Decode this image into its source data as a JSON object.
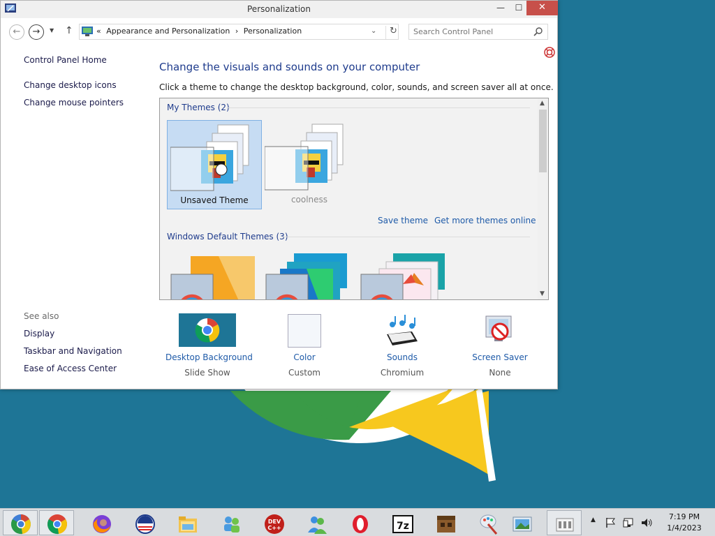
{
  "window": {
    "title": "Personalization",
    "minimize_glyph": "—",
    "maximize_glyph": "☐",
    "close_glyph": "✕"
  },
  "nav": {
    "back_glyph": "←",
    "forward_glyph": "→",
    "dropdown_glyph": "▼",
    "up_glyph": "↑"
  },
  "address": {
    "prefix": "«",
    "crumb_1": "Appearance and Personalization",
    "separator": "›",
    "crumb_2": "Personalization",
    "dropdown_glyph": "⌄",
    "refresh_glyph": "↻"
  },
  "search": {
    "placeholder": "Search Control Panel"
  },
  "sidebar": {
    "items": [
      "Control Panel Home",
      "Change desktop icons",
      "Change mouse pointers"
    ],
    "see_also_title": "See also",
    "see_also": [
      "Display",
      "Taskbar and Navigation",
      "Ease of Access Center"
    ]
  },
  "main": {
    "heading": "Change the visuals and sounds on your computer",
    "subtext": "Click a theme to change the desktop background, color, sounds, and screen saver all at once."
  },
  "themes": {
    "my_themes_title": "My Themes (2)",
    "my_themes": [
      {
        "name": "Unsaved Theme",
        "selected": true
      },
      {
        "name": "coolness",
        "selected": false
      }
    ],
    "save_theme": "Save theme",
    "get_more": "Get more themes online",
    "default_title": "Windows Default Themes (3)",
    "scroll_up": "▲",
    "scroll_down": "▼"
  },
  "tiles": [
    {
      "label": "Desktop Background",
      "value": "Slide Show"
    },
    {
      "label": "Color",
      "value": "Custom"
    },
    {
      "label": "Sounds",
      "value": "Chromium"
    },
    {
      "label": "Screen Saver",
      "value": "None"
    }
  ],
  "taskbar": {
    "items": [
      "chromium-icon",
      "chrome-icon",
      "firefox-icon",
      "obama-logo-icon",
      "file-explorer-icon",
      "messenger-icon",
      "dev-cpp-icon",
      "msn-messenger-icon",
      "opera-icon",
      "7zip-icon",
      "minecraft-icon",
      "paint-icon",
      "photo-viewer-icon",
      "control-panel-icon"
    ],
    "devcpp_text": "DEV\nC++",
    "sevenzip_text": "7z",
    "tray_expand": "▲",
    "time": "7:19 PM",
    "date": "1/4/2023"
  },
  "colors": {
    "accent": "#1e5aa8",
    "heading": "#1e3b8c",
    "close_red": "#c7504a",
    "desktop": "#1e7596"
  }
}
